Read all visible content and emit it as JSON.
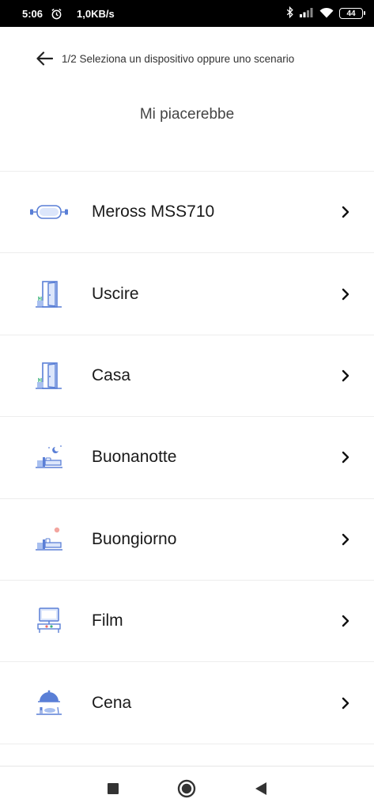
{
  "status_bar": {
    "time": "5:06",
    "speed": "1,0KB/s",
    "battery": "44"
  },
  "header": {
    "title": "1/2 Seleziona un dispositivo oppure uno scenario"
  },
  "subtitle": "Mi piacerebbe",
  "items": [
    {
      "label": "Meross MSS710",
      "icon": "device-icon"
    },
    {
      "label": "Uscire",
      "icon": "door-exit-icon"
    },
    {
      "label": "Casa",
      "icon": "door-home-icon"
    },
    {
      "label": "Buonanotte",
      "icon": "bed-night-icon"
    },
    {
      "label": "Buongiorno",
      "icon": "bed-morning-icon"
    },
    {
      "label": "Film",
      "icon": "tv-icon"
    },
    {
      "label": "Cena",
      "icon": "dinner-icon"
    }
  ],
  "colors": {
    "icon_blue": "#5a7fd6",
    "icon_light_blue": "#a9c0f0",
    "divider": "#ededed"
  }
}
